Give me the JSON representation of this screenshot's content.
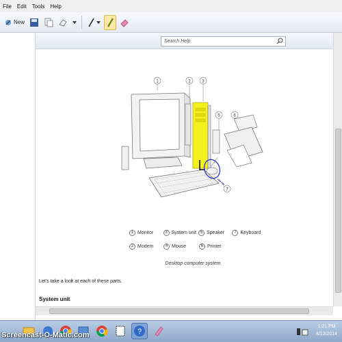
{
  "menu": [
    "File",
    "Edit",
    "Tools",
    "Help"
  ],
  "toolbar": {
    "new_label": "New"
  },
  "search": {
    "placeholder": "Search Help"
  },
  "diagram": {
    "callouts": [
      "1",
      "2",
      "3",
      "5",
      "6",
      "7"
    ]
  },
  "legend": [
    [
      {
        "num": "1",
        "label": "Monitor"
      },
      {
        "num": "3",
        "label": "System unit"
      },
      {
        "num": "5",
        "label": "Speaker"
      },
      {
        "num": "7",
        "label": "Keyboard"
      }
    ],
    [
      {
        "num": "2",
        "label": "Modem"
      },
      {
        "num": "4",
        "label": "Mouse"
      },
      {
        "num": "6",
        "label": "Printer"
      }
    ]
  ],
  "caption": "Desktop computer system",
  "intro_text": "Let's take a look at each of these parts.",
  "section_heading": "System unit",
  "taskbar": {
    "watermark": "Screencast-O-Matic.com"
  },
  "clock": {
    "time": "1:21 PM",
    "date": "8/12/2014"
  },
  "colors": {
    "highlight": "#f5f11f",
    "pen_circle": "#2a35c9",
    "taskbar": "#a6bcd9"
  }
}
